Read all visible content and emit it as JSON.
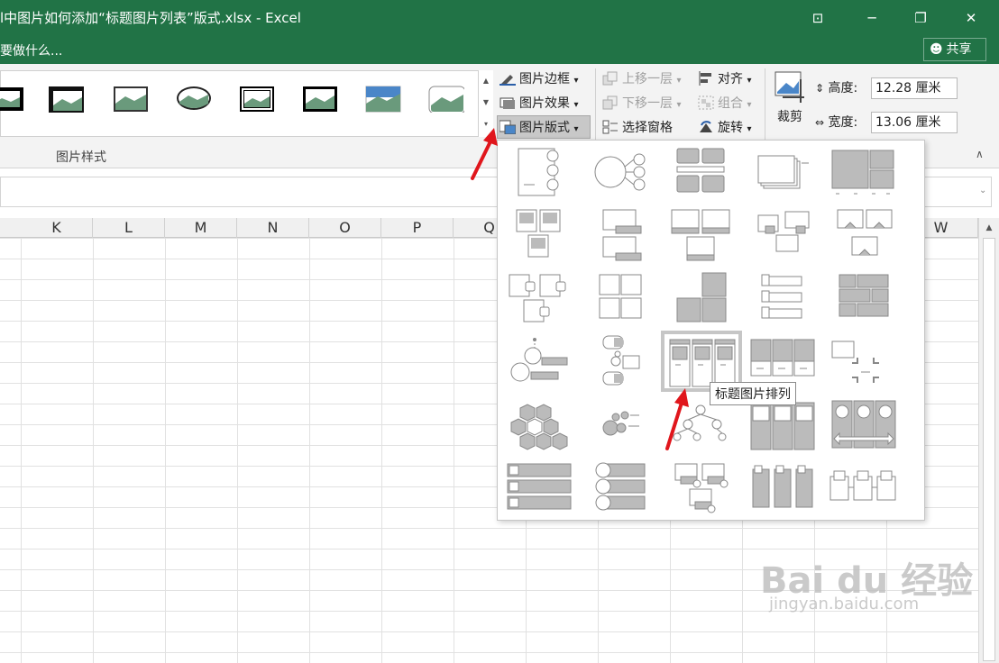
{
  "window": {
    "title": "l中图片如何添加“标题图片列表”版式.xlsx - Excel",
    "controls": [
      "⊡",
      "─",
      "❐",
      "✕"
    ]
  },
  "tellme": {
    "text": "要做什么...",
    "share_label": "共享"
  },
  "ribbon": {
    "picture_styles_label": "图片样式",
    "buttons": {
      "border": "图片边框",
      "effects": "图片效果",
      "layout": "图片版式",
      "bring_forward": "上移一层",
      "send_backward": "下移一层",
      "selection_pane": "选择窗格",
      "align": "对齐",
      "group": "组合",
      "rotate": "旋转",
      "crop": "裁剪"
    },
    "size": {
      "height_label": "高度:",
      "height_value": "12.28 厘米",
      "width_label": "宽度:",
      "width_value": "13.06 厘米"
    }
  },
  "grid": {
    "columns": [
      "K",
      "L",
      "M",
      "N",
      "O",
      "P",
      "Q",
      "W"
    ]
  },
  "layout_gallery": {
    "tooltip": "标题图片排列",
    "hovered_item": "标题图片排列"
  },
  "colors": {
    "excel_green": "#217346",
    "arrow_red": "#e0161c"
  },
  "watermark": {
    "brand": "Bai du 经验",
    "url": "jingyan.baidu.com"
  }
}
